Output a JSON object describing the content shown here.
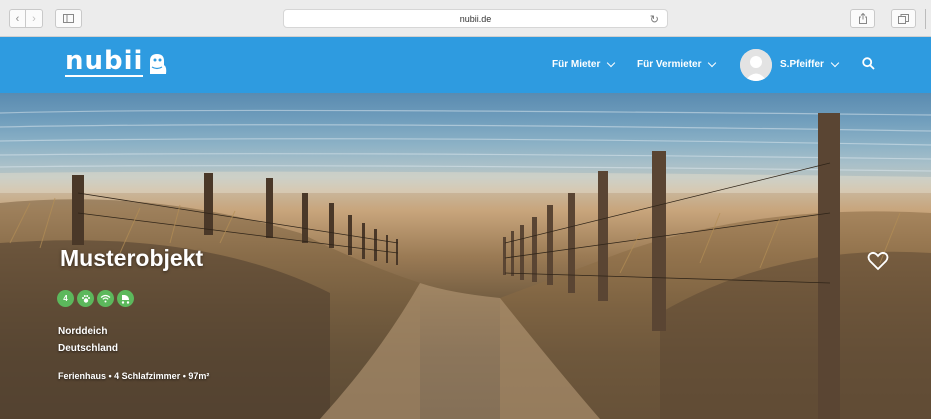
{
  "browser": {
    "url": "nubii.de",
    "icons": {
      "back": "chevron-left-icon",
      "forward": "chevron-right-icon",
      "sidebar": "sidebar-icon",
      "reload": "reload-icon",
      "share": "share-icon",
      "tabs": "tabs-icon"
    }
  },
  "header": {
    "logo_text": "nubii",
    "nav": [
      {
        "label": "Für Mieter"
      },
      {
        "label": "Für Vermieter"
      }
    ],
    "user": {
      "name": "S.Pfeiffer"
    },
    "colors": {
      "bar": "#2e9be0"
    }
  },
  "listing": {
    "title": "Musterobjekt",
    "amenities": [
      {
        "icon": "bed-icon",
        "text": "4"
      },
      {
        "icon": "paw-icon",
        "text": ""
      },
      {
        "icon": "wifi-icon",
        "text": ""
      },
      {
        "icon": "baby-icon",
        "text": ""
      }
    ],
    "city": "Norddeich",
    "country": "Deutschland",
    "details": "Ferienhaus • 4 Schlafzimmer • 97m²",
    "amenity_color": "#5cb85c"
  }
}
